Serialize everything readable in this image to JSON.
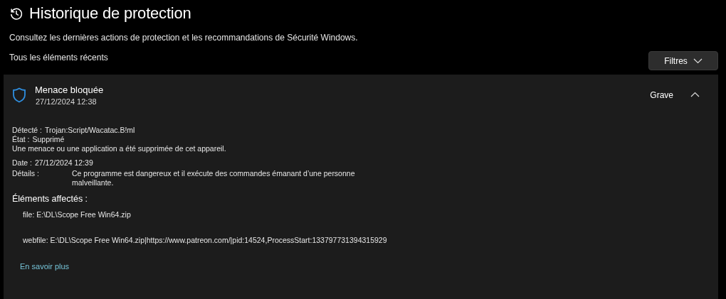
{
  "page": {
    "title": "Historique de protection",
    "subtitle": "Consultez les dernières actions de protection et les recommandations de Sécurité Windows.",
    "section_label": "Tous les éléments récents",
    "filter_button": "Filtres"
  },
  "event": {
    "title": "Menace bloquée",
    "timestamp": "27/12/2024 12:38",
    "severity": "Grave",
    "expanded": true,
    "detected_label": "Détecté :",
    "detected_value": "Trojan:Script/Wacatac.B!ml",
    "state_label": "État :",
    "state_value": "Supprimé",
    "state_description": "Une menace ou une application a été supprimée de cet appareil.",
    "date_label": "Date :",
    "date_value": "27/12/2024 12:39",
    "details_label": "Détails :",
    "details_value": "Ce programme est dangereux et il exécute des commandes émanant d’une personne malveillante.",
    "affected_heading": "Éléments affectés :",
    "affected_items": [
      "file: E:\\DL\\Scope Free Win64.zip",
      "webfile: E:\\DL\\Scope Free Win64.zip|https://www.patreon.com/|pid:14524,ProcessStart:133797731394315929"
    ],
    "learn_more": "En savoir plus"
  }
}
